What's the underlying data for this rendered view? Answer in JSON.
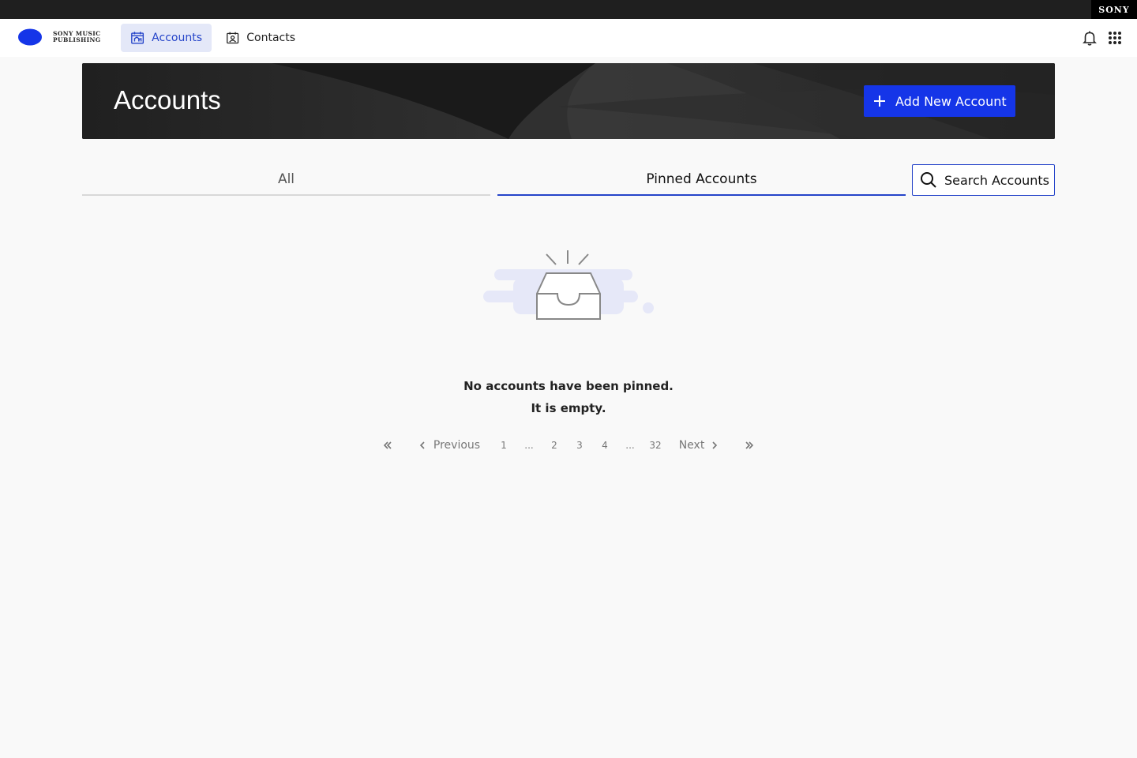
{
  "corner_brand": "SONY",
  "brand": {
    "line1": "SONY MUSIC",
    "line2": "PUBLISHING",
    "accent_color": "#1535e8"
  },
  "nav": {
    "items": [
      {
        "label": "Accounts",
        "icon": "accounts-calendar-icon",
        "active": true
      },
      {
        "label": "Contacts",
        "icon": "contact-card-icon",
        "active": false
      }
    ],
    "right_icons": [
      "bell-icon",
      "apps-grid-icon"
    ]
  },
  "header": {
    "title": "Accounts",
    "add_button_label": "Add New Account"
  },
  "tabs": [
    {
      "label": "All",
      "active": false
    },
    {
      "label": "Pinned Accounts",
      "active": true
    }
  ],
  "search_button_label": "Search Accounts",
  "empty_state": {
    "line1": "No accounts have been pinned.",
    "line2": "It is empty."
  },
  "pagination": {
    "previous_label": "Previous",
    "next_label": "Next",
    "pages": [
      "1",
      "...",
      "2",
      "3",
      "4",
      "...",
      "32"
    ]
  },
  "colors": {
    "primary": "#1535e8",
    "active_tab": "#2544c9",
    "banner_bg": "#2a2a2a"
  }
}
